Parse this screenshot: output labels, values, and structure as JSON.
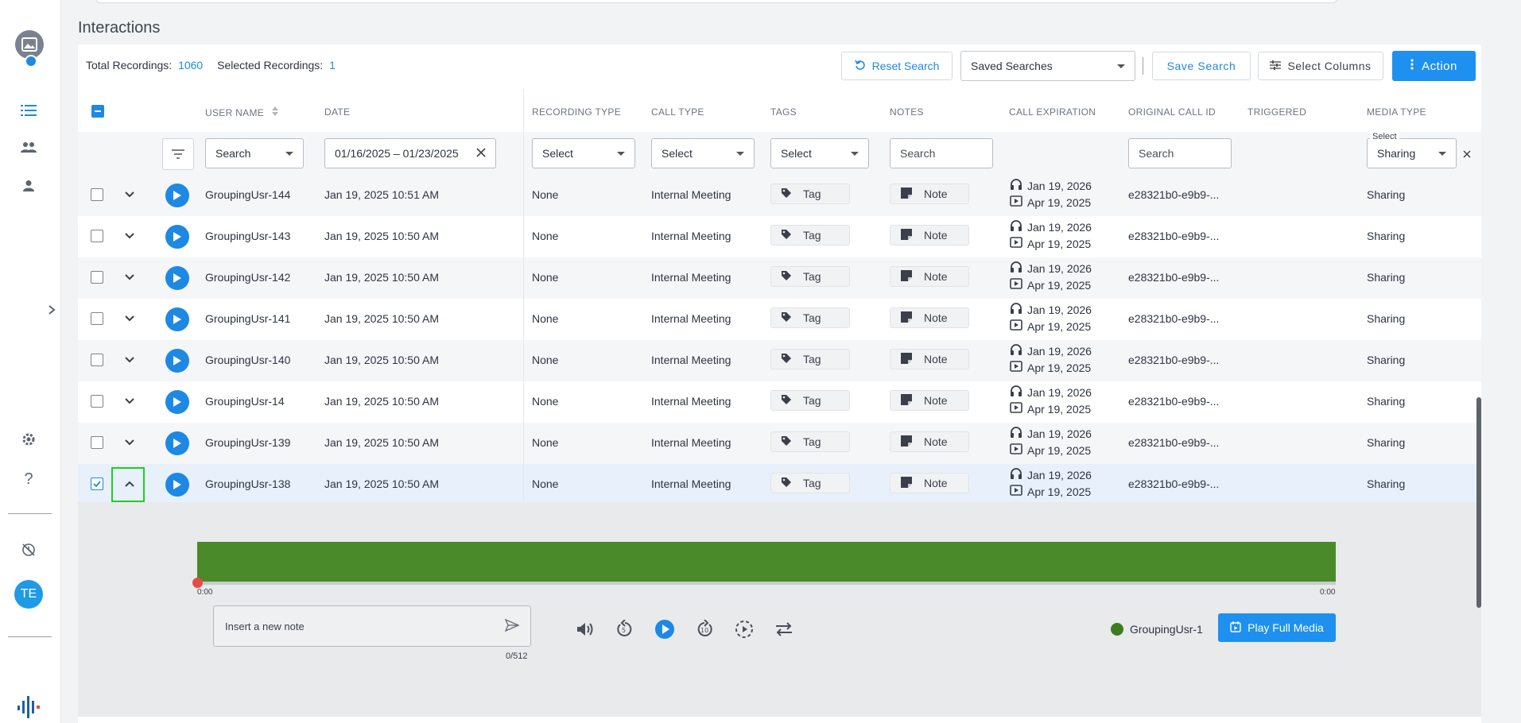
{
  "page": {
    "title": "Interactions"
  },
  "rail": {
    "user_initials": "TE",
    "icons": [
      "image-icon",
      "list-icon",
      "group-icon",
      "person-icon",
      "gear-icon",
      "help-icon",
      "history-icon",
      "brand-logo-icon"
    ]
  },
  "toolbar": {
    "total_label": "Total Recordings:",
    "total_value": "1060",
    "selected_label": "Selected Recordings:",
    "selected_value": "1",
    "reset_label": "Reset Search",
    "saved_searches_label": "Saved Searches",
    "save_search_label": "Save Search",
    "select_columns_label": "Select Columns",
    "action_label": "Action"
  },
  "columns": {
    "user_name": "USER NAME",
    "date": "DATE",
    "recording_type": "RECORDING TYPE",
    "call_type": "CALL TYPE",
    "tags": "TAGS",
    "notes": "NOTES",
    "call_expiration": "CALL EXPIRATION",
    "original_call_id": "ORIGINAL CALL ID",
    "triggered": "TRIGGERED",
    "media_type": "MEDIA TYPE"
  },
  "filters": {
    "user_name": "Search",
    "date_range": "01/16/2025 – 01/23/2025",
    "recording_type": "Select",
    "call_type": "Select",
    "tags": "Select",
    "notes": "Search",
    "original_call_id": "Search",
    "media_type_label": "Select",
    "media_type_value": "Sharing"
  },
  "rows": [
    {
      "user": "GroupingUsr-144",
      "date": "Jan 19, 2025 10:51 AM",
      "recording_type": "None",
      "call_type": "Internal Meeting",
      "tag": "Tag",
      "note": "Note",
      "exp_audio": "Jan 19, 2026",
      "exp_video": "Apr 19, 2025",
      "call_id": "e28321b0-e9b9-...",
      "media": "Sharing"
    },
    {
      "user": "GroupingUsr-143",
      "date": "Jan 19, 2025 10:50 AM",
      "recording_type": "None",
      "call_type": "Internal Meeting",
      "tag": "Tag",
      "note": "Note",
      "exp_audio": "Jan 19, 2026",
      "exp_video": "Apr 19, 2025",
      "call_id": "e28321b0-e9b9-...",
      "media": "Sharing"
    },
    {
      "user": "GroupingUsr-142",
      "date": "Jan 19, 2025 10:50 AM",
      "recording_type": "None",
      "call_type": "Internal Meeting",
      "tag": "Tag",
      "note": "Note",
      "exp_audio": "Jan 19, 2026",
      "exp_video": "Apr 19, 2025",
      "call_id": "e28321b0-e9b9-...",
      "media": "Sharing"
    },
    {
      "user": "GroupingUsr-141",
      "date": "Jan 19, 2025 10:50 AM",
      "recording_type": "None",
      "call_type": "Internal Meeting",
      "tag": "Tag",
      "note": "Note",
      "exp_audio": "Jan 19, 2026",
      "exp_video": "Apr 19, 2025",
      "call_id": "e28321b0-e9b9-...",
      "media": "Sharing"
    },
    {
      "user": "GroupingUsr-140",
      "date": "Jan 19, 2025 10:50 AM",
      "recording_type": "None",
      "call_type": "Internal Meeting",
      "tag": "Tag",
      "note": "Note",
      "exp_audio": "Jan 19, 2026",
      "exp_video": "Apr 19, 2025",
      "call_id": "e28321b0-e9b9-...",
      "media": "Sharing"
    },
    {
      "user": "GroupingUsr-14",
      "date": "Jan 19, 2025 10:50 AM",
      "recording_type": "None",
      "call_type": "Internal Meeting",
      "tag": "Tag",
      "note": "Note",
      "exp_audio": "Jan 19, 2026",
      "exp_video": "Apr 19, 2025",
      "call_id": "e28321b0-e9b9-...",
      "media": "Sharing"
    },
    {
      "user": "GroupingUsr-139",
      "date": "Jan 19, 2025 10:50 AM",
      "recording_type": "None",
      "call_type": "Internal Meeting",
      "tag": "Tag",
      "note": "Note",
      "exp_audio": "Jan 19, 2026",
      "exp_video": "Apr 19, 2025",
      "call_id": "e28321b0-e9b9-...",
      "media": "Sharing"
    },
    {
      "user": "GroupingUsr-138",
      "date": "Jan 19, 2025 10:50 AM",
      "recording_type": "None",
      "call_type": "Internal Meeting",
      "tag": "Tag",
      "note": "Note",
      "exp_audio": "Jan 19, 2026",
      "exp_video": "Apr 19, 2025",
      "call_id": "e28321b0-e9b9-...",
      "media": "Sharing"
    }
  ],
  "player": {
    "time_start": "0:00",
    "time_end": "0:00",
    "note_placeholder": "Insert a new note",
    "note_counter": "0/512",
    "legend_user": "GroupingUsr-1",
    "play_full_label": "Play Full Media"
  },
  "colors": {
    "accent": "#1e88e5",
    "waveform": "#4a8a2a",
    "playhead": "#e84a4a",
    "legend_dot": "#3a7d1e",
    "focus_outline": "#22cc22"
  }
}
